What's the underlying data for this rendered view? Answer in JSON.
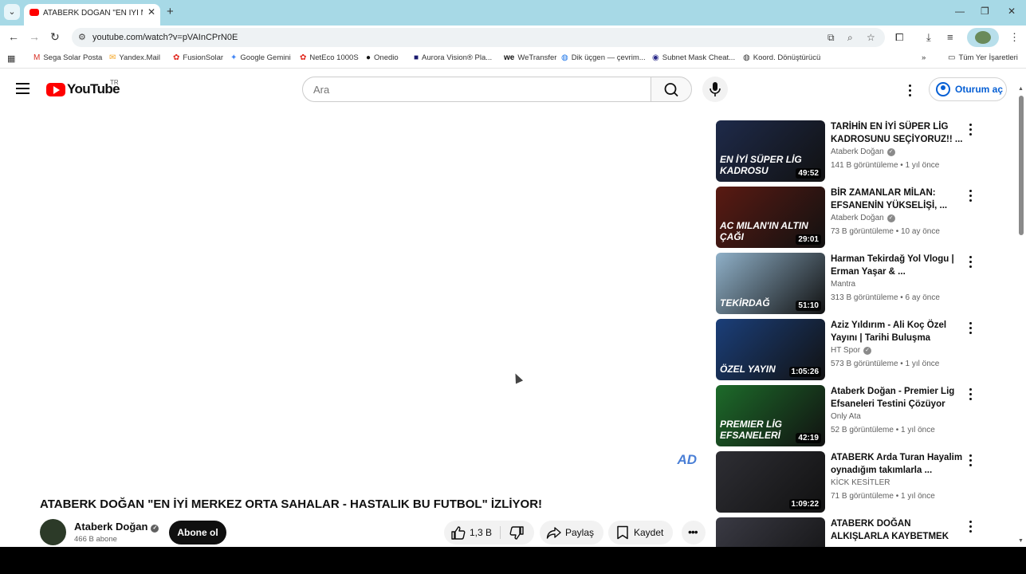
{
  "browser": {
    "tab_title": "ATABERK DOĞAN \"EN İYİ MERK",
    "url": "youtube.com/watch?v=pVAInCPrN0E",
    "all_bookmarks_label": "Tüm Yer İşaretleri",
    "bookmarks": [
      {
        "label": "Sega Solar Posta",
        "icon": "gmail-icon",
        "color": "#d93025"
      },
      {
        "label": "Yandex.Mail",
        "icon": "yandex-mail-icon",
        "color": "#f5a623"
      },
      {
        "label": "FusionSolar",
        "icon": "huawei-icon",
        "color": "#e0251b"
      },
      {
        "label": "Google Gemini",
        "icon": "gemini-icon",
        "color": "#4285f4"
      },
      {
        "label": "NetEco 1000S",
        "icon": "huawei-icon",
        "color": "#e0251b"
      },
      {
        "label": "Onedio",
        "icon": "onedio-icon",
        "color": "#111111"
      },
      {
        "label": "Aurora Vision® Pla...",
        "icon": "aurora-icon",
        "color": "#1a1a6e"
      },
      {
        "label": "WeTransfer",
        "icon": "wetransfer-icon",
        "color": "#111111"
      },
      {
        "label": "Dik üçgen — çevrim...",
        "icon": "globe-icon",
        "color": "#1a73e8"
      },
      {
        "label": "Subnet Mask Cheat...",
        "icon": "subnet-icon",
        "color": "#2a2a8a"
      },
      {
        "label": "Koord. Dönüştürücü",
        "icon": "globe-icon",
        "color": "#333333"
      }
    ]
  },
  "header": {
    "wordmark": "YouTube",
    "country": "TR",
    "search_placeholder": "Ara",
    "signin_label": "Oturum aç"
  },
  "video": {
    "title": "ATABERK DOĞAN \"EN İYİ MERKEZ ORTA SAHALAR - HASTALIK BU FUTBOL\" İZLİYOR!",
    "channel": "Ataberk Doğan",
    "subscribers": "466 B abone",
    "subscribe_label": "Abone ol",
    "likes": "1,3 B",
    "share_label": "Paylaş",
    "save_label": "Kaydet"
  },
  "recommendations": [
    {
      "title": "TARİHİN EN İYİ SÜPER LİG KADROSUNU SEÇİYORUZ!! ...",
      "channel": "Ataberk Doğan",
      "verified": true,
      "meta": "141 B görüntüleme • 1 yıl önce",
      "duration": "49:52",
      "thumb_label": "EN İYİ SÜPER LİG KADROSU",
      "thumb_color": "#1e2a4a"
    },
    {
      "title": "BİR ZAMANLAR MİLAN: EFSANENİN YÜKSELİŞİ, ...",
      "channel": "Ataberk Doğan",
      "verified": true,
      "meta": "73 B görüntüleme • 10 ay önce",
      "duration": "29:01",
      "thumb_label": "AC MILAN'IN ALTIN ÇAĞI",
      "thumb_color": "#5a1a12"
    },
    {
      "title": "Harman Tekirdağ Yol Vlogu | Erman Yaşar & ...",
      "channel": "Mantra",
      "verified": false,
      "meta": "313 B görüntüleme • 6 ay önce",
      "duration": "51:10",
      "thumb_label": "TEKİRDAĞ",
      "thumb_color": "#8fb0c8"
    },
    {
      "title": "Aziz Yıldırım - Ali Koç Özel Yayını | Tarihi Buluşma",
      "channel": "HT Spor",
      "verified": true,
      "meta": "573 B görüntüleme • 1 yıl önce",
      "duration": "1:05:26",
      "thumb_label": "ÖZEL YAYIN",
      "thumb_color": "#1b3f7a"
    },
    {
      "title": "Ataberk Doğan - Premier Lig Efsaneleri Testini Çözüyor",
      "channel": "Only Ata",
      "verified": false,
      "meta": "52 B görüntüleme • 1 yıl önce",
      "duration": "42:19",
      "thumb_label": "PREMIER LİG EFSANELERİ",
      "thumb_color": "#1d6b2a"
    },
    {
      "title": "ATABERK Arda Turan Hayalim oynadığım takımlarla ...",
      "channel": "KİCK KESİTLER",
      "verified": false,
      "meta": "71 B görüntüleme • 1 yıl önce",
      "duration": "1:09:22",
      "thumb_label": "",
      "thumb_color": "#2e2e34"
    },
    {
      "title": "ATABERK DOĞAN ALKIŞLARLA KAYBETMEK TÜRK ...",
      "channel": "",
      "verified": false,
      "meta": "",
      "duration": "",
      "thumb_label": "",
      "thumb_color": "#3a3a44"
    }
  ],
  "player": {
    "watermark": "AD"
  },
  "colors": {
    "accent": "#065fd4",
    "brand": "#ff0000",
    "tabstrip": "#a7d9e6"
  }
}
